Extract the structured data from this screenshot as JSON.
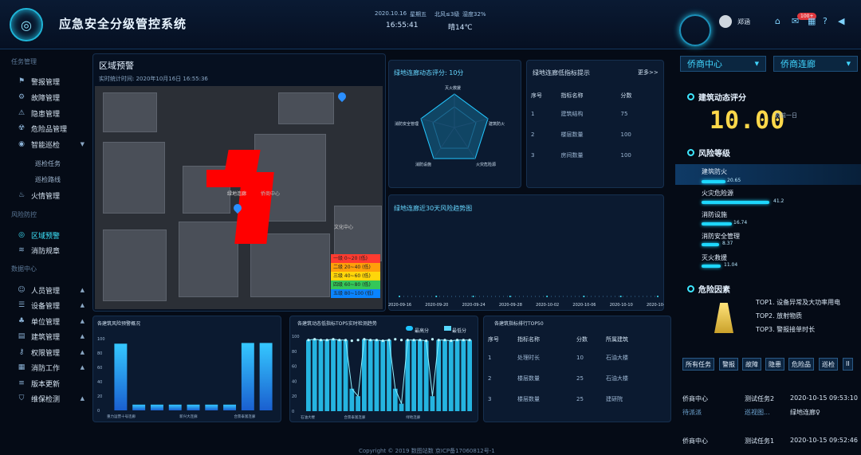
{
  "header": {
    "title": "应急安全分级管控系统",
    "date": "2020.10.16",
    "weekday": "星期五",
    "wind": "北风≤3级",
    "humidity": "湿度32%",
    "time": "16:55:41",
    "weather": "晴14℃",
    "user": "郑涵",
    "notif_badge": "100+"
  },
  "sidebar": {
    "section_task": "任务管理",
    "items_task": [
      {
        "label": "警报管理",
        "icon": "bell-icon"
      },
      {
        "label": "故障管理",
        "icon": "wrench-icon"
      },
      {
        "label": "隐患管理",
        "icon": "warning-icon"
      },
      {
        "label": "危险品管理",
        "icon": "hazard-icon"
      },
      {
        "label": "智能巡检",
        "icon": "patrol-icon",
        "expanded": true
      }
    ],
    "sub_items": [
      "巡检任务",
      "巡检路线"
    ],
    "item_fire": "火情管理",
    "section_risk": "风险防控",
    "items_risk": [
      "区域预警",
      "消防规章"
    ],
    "section_data": "数据中心",
    "items_data": [
      "人员管理",
      "设备管理",
      "单位管理",
      "建筑管理",
      "权限管理",
      "消防工作",
      "版本更新",
      "维保检测"
    ]
  },
  "region": {
    "title": "区域预警",
    "stat_time": "实时统计时间: 2020年10月16日 16:55:36",
    "map_labels": [
      "绿地连廊",
      "文化中心",
      "侨商中心"
    ],
    "legend": [
      {
        "label": "一级 0~20 (低)",
        "color": "#ff3b30"
      },
      {
        "label": "二级 20~40 (低)",
        "color": "#ff9f0a"
      },
      {
        "label": "三级 40~60 (低)",
        "color": "#ffd60a"
      },
      {
        "label": "四级 60~80 (低)",
        "color": "#34c759"
      },
      {
        "label": "五级 80~100 (低)",
        "color": "#0a84ff"
      }
    ]
  },
  "radar": {
    "title": "绿地连廊动态评分: 10分",
    "axes": [
      "灭火救援",
      "建筑防火",
      "火灾危险源",
      "消防设施",
      "消防安全管理"
    ]
  },
  "lowtop": {
    "title": "绿地连廊低指标提示",
    "more": "更多>>",
    "headers": [
      "序号",
      "指标名称",
      "分数"
    ],
    "rows": [
      [
        "1",
        "建筑结构",
        "75"
      ],
      [
        "2",
        "楼层数量",
        "100"
      ],
      [
        "3",
        "房间数量",
        "100"
      ]
    ]
  },
  "trend": {
    "title": "绿地连廊近30天风险趋势图",
    "dates": [
      "2020-09-16",
      "2020-09-20",
      "2020-09-24",
      "2020-09-28",
      "2020-10-02",
      "2020-10-06",
      "2020-10-10",
      "2020-10-14"
    ]
  },
  "bottom1": {
    "title": "各建筑风险预警概况"
  },
  "bottom2": {
    "title": "各建筑动态低指标TOP5实时检测趋势",
    "legend": [
      "最高分",
      "最低分"
    ]
  },
  "bottom3": {
    "title": "各建筑指标排行TOP50",
    "headers": [
      "序号",
      "指标名称",
      "分数",
      "所属建筑"
    ],
    "rows": [
      [
        "1",
        "处理时长",
        "10",
        "石油大楼"
      ],
      [
        "2",
        "楼层数量",
        "25",
        "石油大楼"
      ],
      [
        "3",
        "楼层数量",
        "25",
        "建研院"
      ]
    ]
  },
  "chart_data": [
    {
      "type": "bar",
      "title": "各建筑风险预警概况",
      "ylim": [
        0,
        100
      ],
      "yticks": [
        0,
        20,
        40,
        60,
        80,
        100
      ],
      "categories": [
        "重力运营十号连廊",
        "",
        "",
        "",
        "新兴大连廊",
        "",
        "",
        "合景泰富连廊",
        ""
      ],
      "values": [
        93,
        8,
        8,
        8,
        8,
        8,
        8,
        94,
        94
      ]
    },
    {
      "type": "bar",
      "title": "各建筑动态低指标TOP5实时检测趋势",
      "ylim": [
        0,
        100
      ],
      "yticks": [
        0,
        20,
        40,
        60,
        80,
        100
      ],
      "categories": [
        "石油大楼",
        "",
        "",
        "",
        "",
        "",
        "",
        "合景泰富连廊",
        "",
        "",
        "",
        "",
        "",
        "",
        "",
        "",
        "",
        "绿地连廊",
        "",
        "",
        "",
        "",
        "",
        "",
        "",
        "",
        ""
      ],
      "series": [
        {
          "name": "最高分",
          "values": [
            95,
            96,
            95,
            95,
            96,
            95,
            95,
            94,
            95,
            96,
            95,
            95,
            94,
            95,
            96,
            95,
            95,
            95,
            95,
            94,
            96,
            95,
            95,
            94,
            95,
            95,
            95
          ]
        },
        {
          "name": "最低分",
          "values": [
            95,
            96,
            95,
            95,
            96,
            95,
            95,
            30,
            20,
            96,
            95,
            95,
            94,
            95,
            30,
            10,
            95,
            95,
            95,
            94,
            20,
            95,
            95,
            94,
            95,
            95,
            95
          ]
        }
      ]
    }
  ],
  "right": {
    "select1": "侨商中心",
    "select2": "侨商连廊",
    "score_title": "建筑动态评分",
    "score": "10.00",
    "score_sub": "较前一日",
    "level_title": "风险等级",
    "levels": [
      {
        "label": "建筑防火",
        "value": "20.65",
        "frac": 0.55
      },
      {
        "label": "火灾危险源",
        "value": "41.2",
        "frac": 0.85
      },
      {
        "label": "消防设施",
        "value": "16.74",
        "frac": 0.45
      },
      {
        "label": "消防安全管理",
        "value": "8.37",
        "frac": 0.3
      },
      {
        "label": "灭火救援",
        "value": "11.04",
        "frac": 0.35
      }
    ],
    "hazard_title": "危险因素",
    "hazards": [
      "TOP1. 设备异常及大功率用电",
      "TOP2. 放射物质",
      "TOP3. 警报接单时长"
    ],
    "tabs": [
      "所有任务",
      "警报",
      "故障",
      "隐患",
      "危险品",
      "巡检",
      "II"
    ],
    "tasks": [
      {
        "place": "侨商中心",
        "name": "测试任务2",
        "time": "2020-10-15 09:53:10",
        "status": "待派派",
        "type": "巡视图...",
        "loc": "绿地连廊♀"
      },
      {
        "place": "侨商中心",
        "name": "测试任务1",
        "time": "2020-10-15 09:52:46"
      }
    ]
  },
  "footer": "Copyright © 2019 数图站数 京ICP备17060812号-1"
}
